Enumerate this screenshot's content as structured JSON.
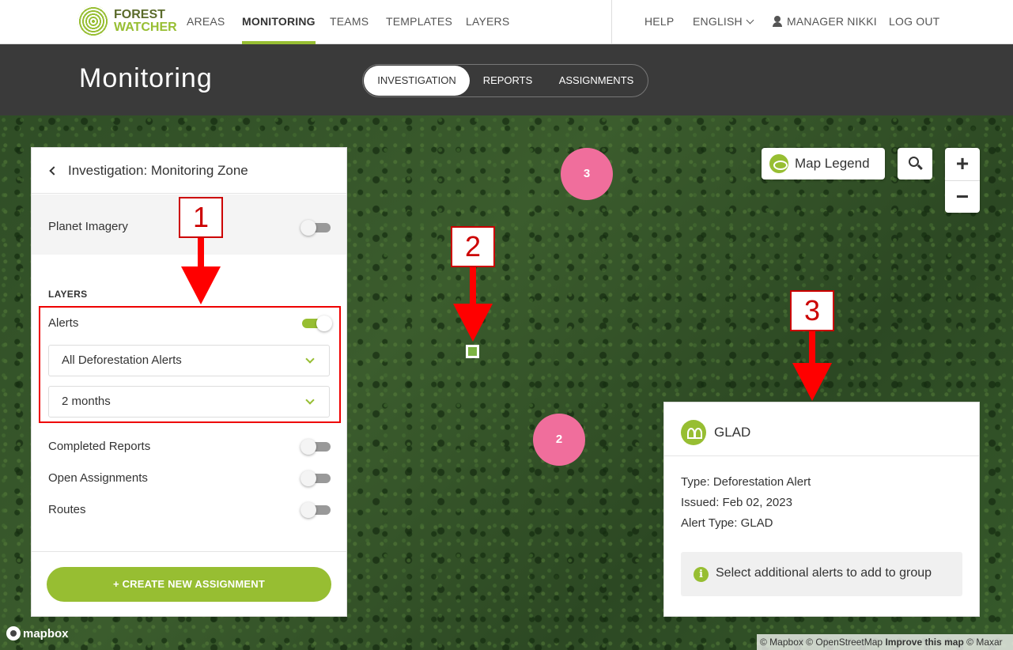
{
  "brand": {
    "line1": "FOREST",
    "line2": "WATCHER"
  },
  "nav": {
    "areas": "AREAS",
    "monitoring": "MONITORING",
    "teams": "TEAMS",
    "templates": "TEMPLATES",
    "layers": "LAYERS",
    "help": "HELP",
    "language": "ENGLISH",
    "user": "MANAGER NIKKI",
    "logout": "LOG OUT"
  },
  "header": {
    "title": "Monitoring",
    "tabs": [
      {
        "label": "INVESTIGATION",
        "active": true
      },
      {
        "label": "REPORTS",
        "active": false
      },
      {
        "label": "ASSIGNMENTS",
        "active": false
      }
    ]
  },
  "panel": {
    "title": "Investigation: Monitoring Zone",
    "planet_imagery": {
      "label": "Planet Imagery",
      "on": false
    },
    "layers_heading": "LAYERS",
    "alerts": {
      "label": "Alerts",
      "on": true
    },
    "alert_type_select": "All Deforestation Alerts",
    "timeframe_select": "2 months",
    "completed_reports": {
      "label": "Completed Reports",
      "on": false
    },
    "open_assignments": {
      "label": "Open Assignments",
      "on": false
    },
    "routes": {
      "label": "Routes",
      "on": false
    },
    "create_button": "+ CREATE NEW ASSIGNMENT"
  },
  "map": {
    "legend_label": "Map Legend",
    "zoom_in": "+",
    "zoom_out": "−",
    "clusters": [
      "3",
      "2"
    ],
    "mapbox_label": "mapbox",
    "attribution": {
      "mapbox": "© Mapbox",
      "osm": "© OpenStreetMap",
      "improve": "Improve this map",
      "maxar": "© Maxar"
    }
  },
  "annotations": [
    "1",
    "2",
    "3"
  ],
  "alert_card": {
    "title": "GLAD",
    "type_line": "Type: Deforestation Alert",
    "issued_line": "Issued: Feb 02, 2023",
    "alert_type_line": "Alert Type: GLAD",
    "note": "Select additional alerts to add to group",
    "info_glyph": "i"
  },
  "colors": {
    "accent": "#97be32",
    "header_bg": "#3a3a3a",
    "cluster": "#f06e9c",
    "annotation": "#ff0000"
  }
}
